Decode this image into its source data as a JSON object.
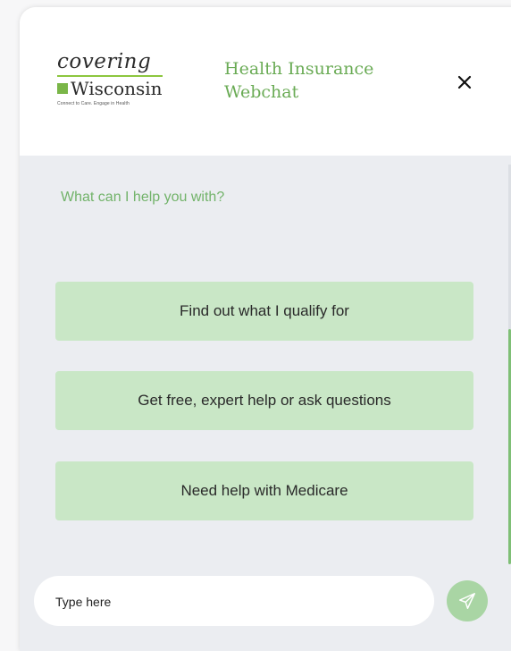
{
  "header": {
    "logo": {
      "line1": "covering",
      "line2": "Wisconsin",
      "tagline": "Connect to Care. Engage in Health"
    },
    "title_line1": "Health Insurance",
    "title_line2": "Webchat",
    "close_label": "×"
  },
  "chat": {
    "prompt": "What can I help you with?",
    "options": [
      {
        "label": "Find out what I qualify for"
      },
      {
        "label": "Get free, expert help or ask questions"
      },
      {
        "label": "Need help with Medicare"
      }
    ]
  },
  "composer": {
    "placeholder": "Type here",
    "value": ""
  },
  "colors": {
    "accent_green": "#6aab55",
    "option_bg": "#c9e7c6",
    "send_bg": "#a9d5a4",
    "chat_bg": "#ebedf1"
  },
  "icons": {
    "close": "close-icon",
    "send": "send-icon"
  }
}
